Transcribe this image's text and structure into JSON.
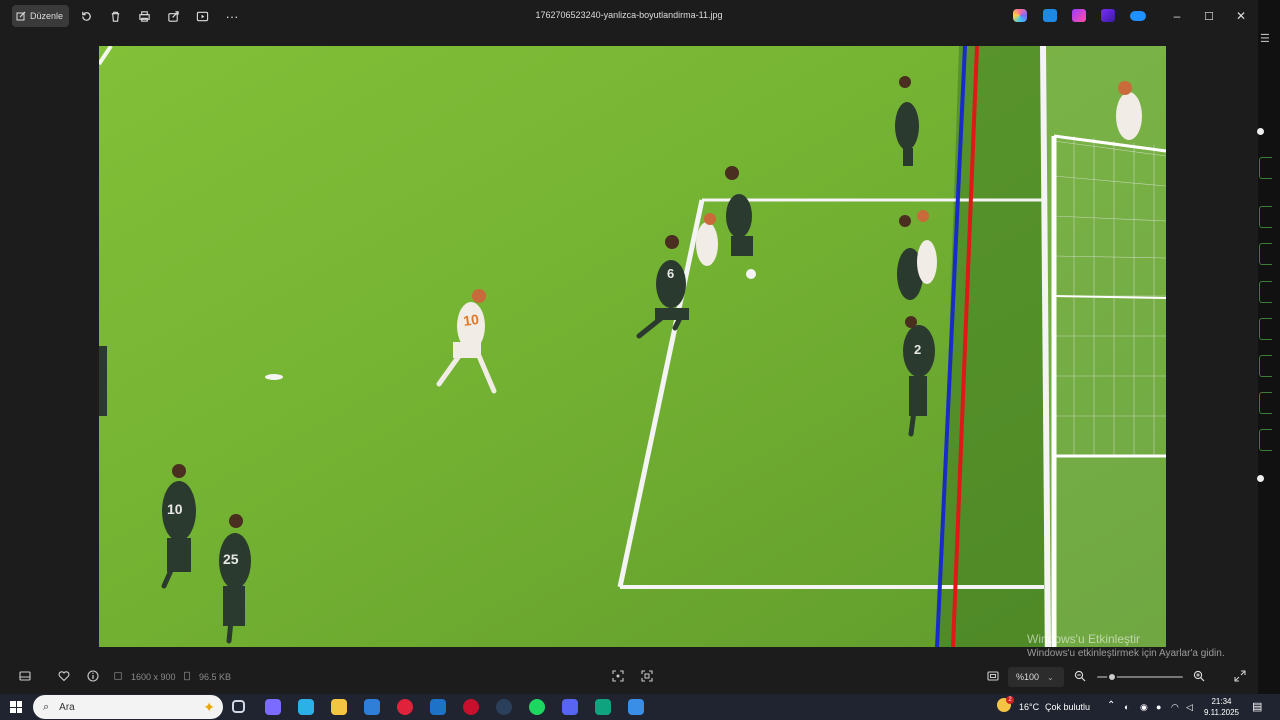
{
  "window": {
    "title": "1762706523240-yanlizca-boyutlandirma-11.jpg",
    "edit_label": "Düzenle",
    "toolbar_icons": [
      "rotate-icon",
      "delete-icon",
      "print-icon",
      "share-icon",
      "slideshow-icon",
      "more-icon"
    ],
    "right_apps": [
      "copilot-icon",
      "photos-editor-icon",
      "clipchamp-icon",
      "designer-icon",
      "onedrive-icon"
    ],
    "controls": {
      "minimize": "–",
      "maximize": "☐",
      "close": "✕"
    }
  },
  "image": {
    "offside_lines": {
      "blue": "#1a2cc8",
      "red": "#e01818"
    },
    "pitch_color": "#73b234"
  },
  "watermark": {
    "line1": "Windows'u Etkinleştir",
    "line2": "Windows'u etkinleştirmek için Ayarlar'a gidin."
  },
  "bottombar": {
    "dimensions": "1600 x 900",
    "file_size": "96.5 KB",
    "zoom": "%100"
  },
  "taskbar": {
    "search_placeholder": "Ara",
    "weather": "16°C",
    "weather_text": "Çok bulutlu",
    "weather_badge": "2",
    "time": "21:34",
    "date": "9.11.2025",
    "apps": [
      {
        "name": "task-view-icon",
        "color": "#cfd6e6"
      },
      {
        "name": "copilot-icon",
        "color": "#7b6cff"
      },
      {
        "name": "edge-icon",
        "color": "#2bb1e8"
      },
      {
        "name": "file-explorer-icon",
        "color": "#f4c542"
      },
      {
        "name": "store-icon",
        "color": "#2f7fd8"
      },
      {
        "name": "opera-icon",
        "color": "#e0233b"
      },
      {
        "name": "outlook-icon",
        "color": "#1e73c8"
      },
      {
        "name": "game-app-icon",
        "color": "#c8102e"
      },
      {
        "name": "steam-icon",
        "color": "#2a3f5a"
      },
      {
        "name": "spotify-icon",
        "color": "#1ed760"
      },
      {
        "name": "discord-icon",
        "color": "#5865f2"
      },
      {
        "name": "chatgpt-icon",
        "color": "#10a37f"
      },
      {
        "name": "photos-icon",
        "color": "#3a8ee6"
      }
    ]
  }
}
